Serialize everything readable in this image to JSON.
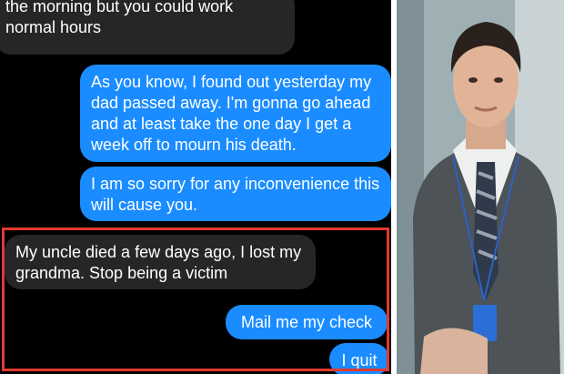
{
  "messages": [
    {
      "from": "them",
      "text": "the morning but you could work normal hours"
    },
    {
      "from": "me",
      "text": "As you know, I found out yesterday my dad passed away. I'm gonna go ahead and at least take the one day I get a week off to mourn his death."
    },
    {
      "from": "me",
      "text": "I am so sorry for any inconvenience this will cause you."
    },
    {
      "from": "them",
      "text": "My uncle died a few days ago, I lost my grandma. Stop being a victim"
    },
    {
      "from": "me",
      "text": "Mail me my check"
    },
    {
      "from": "me",
      "text": "I quit"
    }
  ],
  "colors": {
    "chat_background": "#000000",
    "sent_bubble": "#1a8cff",
    "received_bubble": "#262628",
    "highlight_border": "#e23a2f"
  },
  "photo": {
    "icon": "man-in-suit-photo"
  }
}
